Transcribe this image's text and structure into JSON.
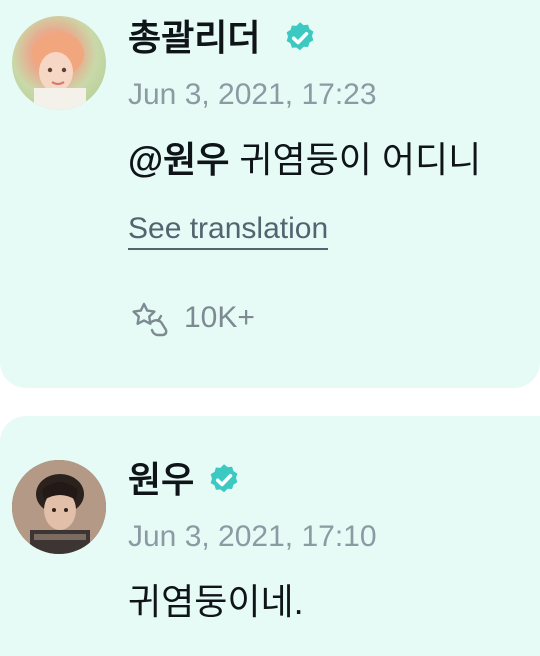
{
  "posts": [
    {
      "author_name": "총괄리더",
      "date": "Jun 3, 2021, 17:23",
      "mention": "@원우",
      "text": " 귀염둥이 어디니",
      "translate_label": "See translation",
      "like_count": "10K+"
    },
    {
      "author_name": "원우",
      "date": "Jun 3, 2021, 17:10",
      "text": "귀염둥이네."
    }
  ],
  "colors": {
    "card_bg": "#e6fbf6",
    "verified_badge": "#3cc9c2",
    "muted_text": "#8b9aa3"
  },
  "icons": {
    "verified": "verified-badge-icon",
    "like": "star-hand-like-icon"
  }
}
